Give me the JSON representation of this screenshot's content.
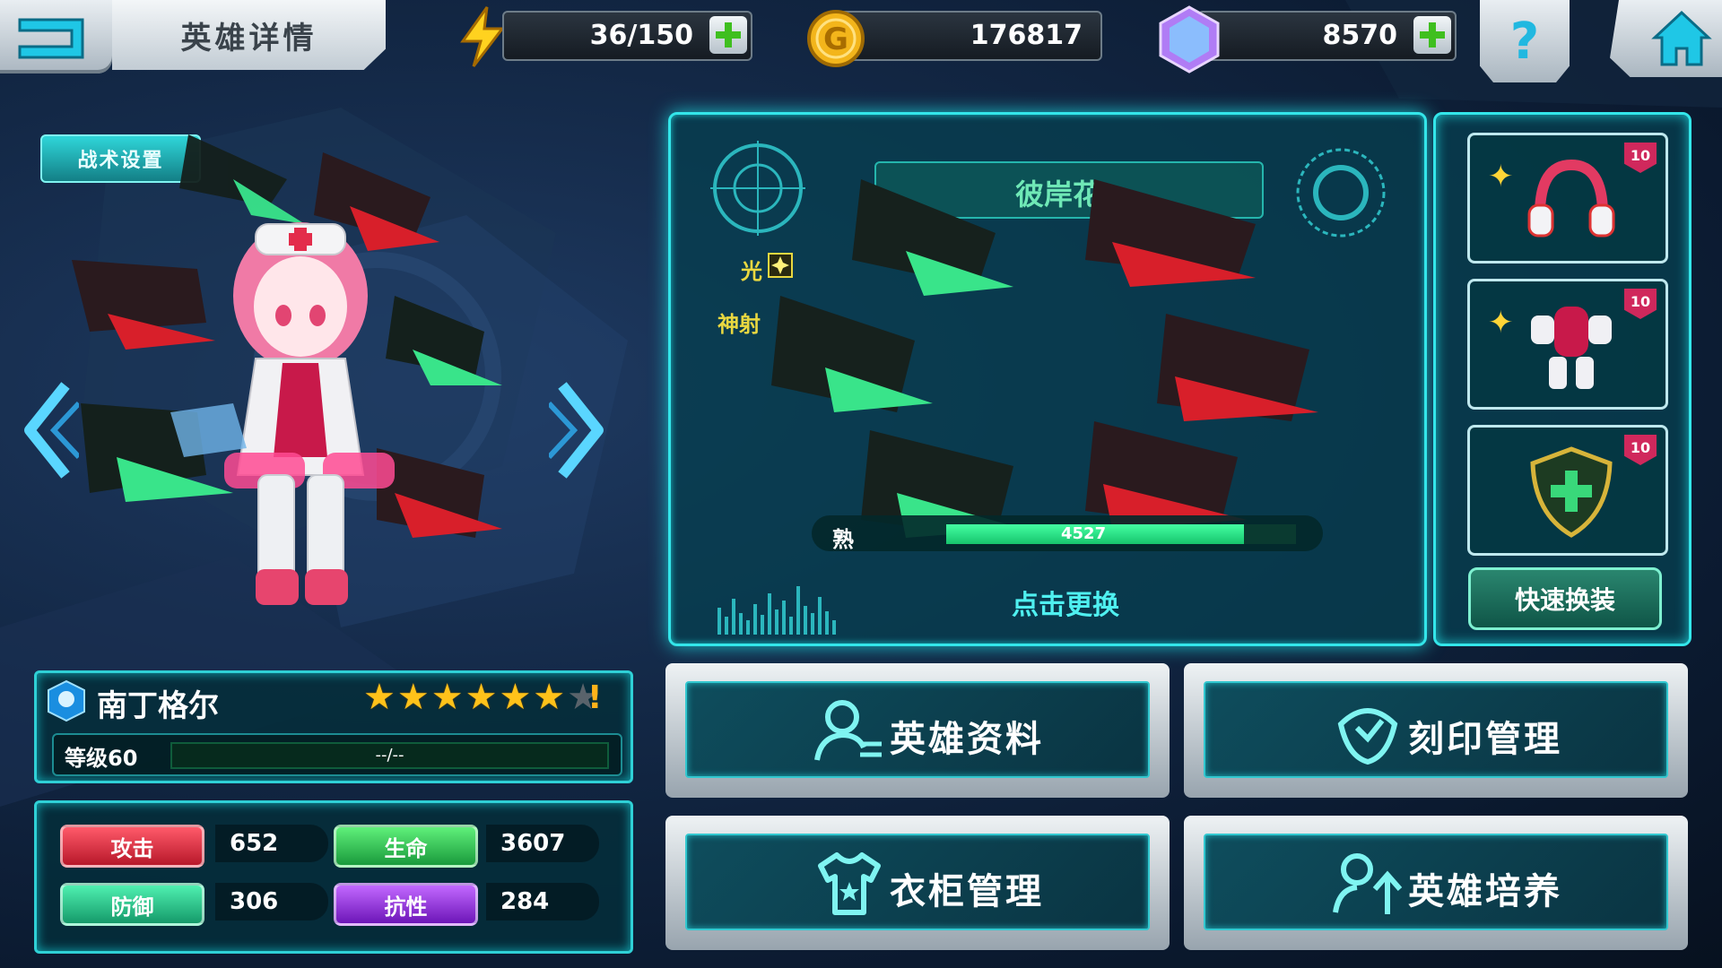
{
  "header": {
    "title": "英雄详情",
    "energy": "36/150",
    "gold": "176817",
    "gems": "8570",
    "help_label": "?"
  },
  "tactics": {
    "label": "战术设置"
  },
  "hero": {
    "name": "南丁格尔",
    "stars": 6,
    "max_stars": 7,
    "warn": "!",
    "level_label": "等级60",
    "exp_text": "--/--"
  },
  "stats": {
    "attack_label": "攻击",
    "attack": "652",
    "hp_label": "生命",
    "hp": "3607",
    "defense_label": "防御",
    "defense": "306",
    "resist_label": "抗性",
    "resist": "284"
  },
  "weapon": {
    "name": "彼岸花",
    "element": "光",
    "skill": "神射",
    "proficiency_label": "熟",
    "proficiency_text": "4527",
    "proficiency_ratio": 0.85,
    "change_label": "点击更换"
  },
  "equipment": {
    "slots": [
      {
        "badge": "10",
        "icon": "headphones-icon"
      },
      {
        "badge": "10",
        "icon": "armor-icon"
      },
      {
        "badge": "10",
        "icon": "shield-emblem-icon"
      }
    ],
    "quick_label": "快速换装"
  },
  "menu": {
    "profile": "英雄资料",
    "imprint": "刻印管理",
    "wardrobe": "衣柜管理",
    "training": "英雄培养"
  },
  "colors": {
    "accent": "#33e6ea",
    "attack": "#e23a4a",
    "hp": "#2bcb56",
    "defense": "#26c38e",
    "resist": "#9b3ae0"
  }
}
